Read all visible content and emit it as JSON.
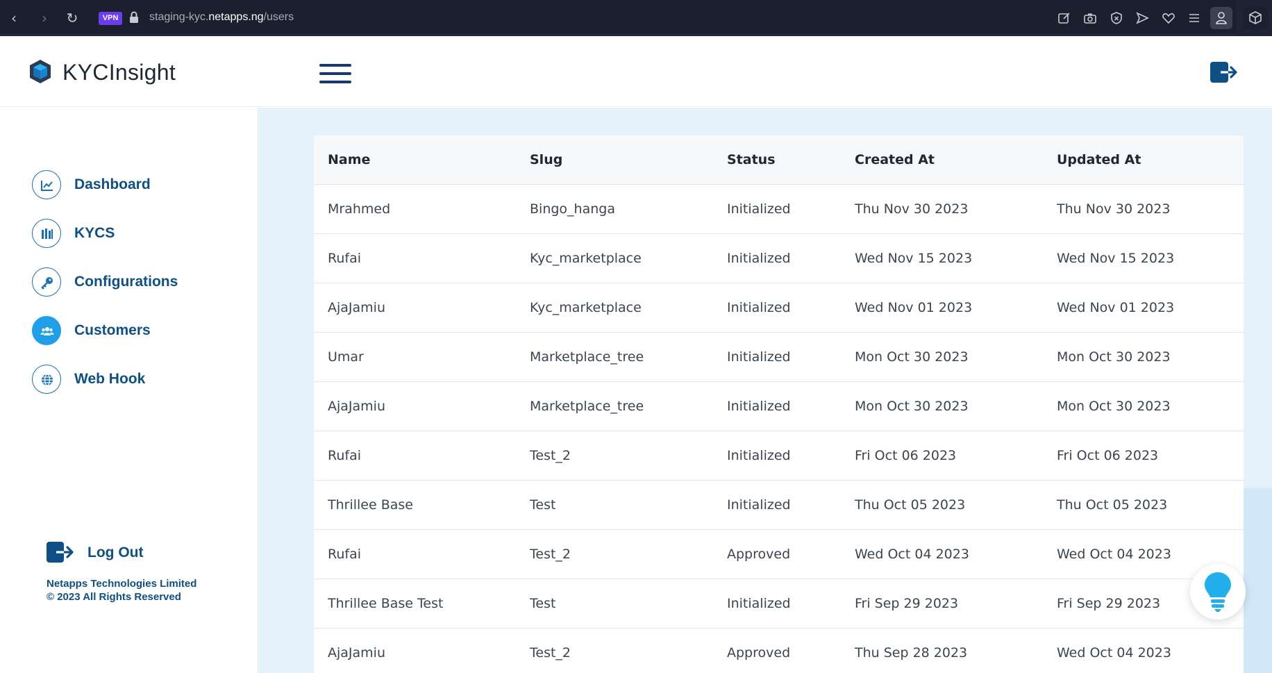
{
  "browser": {
    "vpn_label": "VPN",
    "url_prefix": "staging-kyc.",
    "url_domain": "netapps.ng",
    "url_path": "/users"
  },
  "app": {
    "logo_text": "KYCInsight",
    "accent_color": "#0e4f86",
    "active_color": "#1f9fe8"
  },
  "sidebar": {
    "items": [
      {
        "label": "Dashboard",
        "icon": "chart-icon"
      },
      {
        "label": "KYCS",
        "icon": "files-icon"
      },
      {
        "label": "Configurations",
        "icon": "key-icon"
      },
      {
        "label": "Customers",
        "icon": "users-icon",
        "active": true
      },
      {
        "label": "Web Hook",
        "icon": "globe-icon"
      }
    ],
    "logout_label": "Log Out",
    "footer_company": "Netapps Technologies Limited",
    "footer_rights": "© 2023 All Rights Reserved"
  },
  "table": {
    "columns": [
      "Name",
      "Slug",
      "Status",
      "Created At",
      "Updated At"
    ],
    "rows": [
      [
        "Mrahmed",
        "Bingo_hanga",
        "Initialized",
        "Thu Nov 30 2023",
        "Thu Nov 30 2023"
      ],
      [
        "Rufai",
        "Kyc_marketplace",
        "Initialized",
        "Wed Nov 15 2023",
        "Wed Nov 15 2023"
      ],
      [
        "AjaJamiu",
        "Kyc_marketplace",
        "Initialized",
        "Wed Nov 01 2023",
        "Wed Nov 01 2023"
      ],
      [
        "Umar",
        "Marketplace_tree",
        "Initialized",
        "Mon Oct 30 2023",
        "Mon Oct 30 2023"
      ],
      [
        "AjaJamiu",
        "Marketplace_tree",
        "Initialized",
        "Mon Oct 30 2023",
        "Mon Oct 30 2023"
      ],
      [
        "Rufai",
        "Test_2",
        "Initialized",
        "Fri Oct 06 2023",
        "Fri Oct 06 2023"
      ],
      [
        "Thrillee Base",
        "Test",
        "Initialized",
        "Thu Oct 05 2023",
        "Thu Oct 05 2023"
      ],
      [
        "Rufai",
        "Test_2",
        "Approved",
        "Wed Oct 04 2023",
        "Wed Oct 04 2023"
      ],
      [
        "Thrillee Base Test",
        "Test",
        "Initialized",
        "Fri Sep 29 2023",
        "Fri Sep 29 2023"
      ],
      [
        "AjaJamiu",
        "Test_2",
        "Approved",
        "Thu Sep 28 2023",
        "Wed Oct 04 2023"
      ]
    ]
  }
}
